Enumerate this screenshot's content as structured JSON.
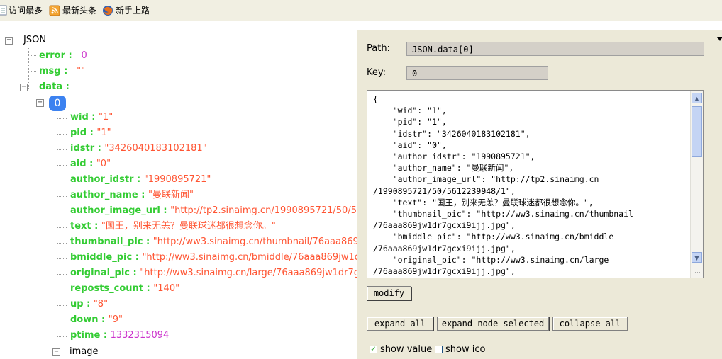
{
  "bookmarks": [
    {
      "label": "访问最多",
      "icon": "page-icon"
    },
    {
      "label": "最新头条",
      "icon": "rss-icon"
    },
    {
      "label": "新手上路",
      "icon": "firefox-icon"
    }
  ],
  "tree": {
    "root": "JSON",
    "error": {
      "key": "error",
      "value": "0"
    },
    "msg": {
      "key": "msg",
      "value": "\"\""
    },
    "data": {
      "key": "data"
    },
    "item_index": "0",
    "fields": [
      {
        "key": "wid",
        "value": "\"1\"",
        "kind": "str"
      },
      {
        "key": "pid",
        "value": "\"1\"",
        "kind": "str"
      },
      {
        "key": "idstr",
        "value": "\"3426040183102181\"",
        "kind": "str"
      },
      {
        "key": "aid",
        "value": "\"0\"",
        "kind": "str"
      },
      {
        "key": "author_idstr",
        "value": "\"1990895721\"",
        "kind": "str"
      },
      {
        "key": "author_name",
        "value": "\"曼联新闻\"",
        "kind": "str"
      },
      {
        "key": "author_image_url",
        "value": "\"http://tp2.sinaimg.cn/1990895721/50/5612239948/1\"",
        "kind": "str"
      },
      {
        "key": "text",
        "value": "\"国王，别来无恙？曼联球迷都很想念你。\"",
        "kind": "str"
      },
      {
        "key": "thumbnail_pic",
        "value": "\"http://ww3.sinaimg.cn/thumbnail/76aaa869jw1dr7gcxi9ijj.jpg\"",
        "kind": "str"
      },
      {
        "key": "bmiddle_pic",
        "value": "\"http://ww3.sinaimg.cn/bmiddle/76aaa869jw1dr7gcxi9ijj.jpg\"",
        "kind": "str"
      },
      {
        "key": "original_pic",
        "value": "\"http://ww3.sinaimg.cn/large/76aaa869jw1dr7gcxi9ijj.jpg\"",
        "kind": "str"
      },
      {
        "key": "reposts_count",
        "value": "\"140\"",
        "kind": "str"
      },
      {
        "key": "up",
        "value": "\"8\"",
        "kind": "str"
      },
      {
        "key": "down",
        "value": "\"9\"",
        "kind": "str"
      },
      {
        "key": "ptime",
        "value": "1332315094",
        "kind": "num"
      }
    ],
    "image_node": "image"
  },
  "panel": {
    "path_label": "Path:",
    "path_value": "JSON.data[0]",
    "key_label": "Key:",
    "key_value": "0",
    "editor_text": "{\n    \"wid\": \"1\",\n    \"pid\": \"1\",\n    \"idstr\": \"3426040183102181\",\n    \"aid\": \"0\",\n    \"author_idstr\": \"1990895721\",\n    \"author_name\": \"曼联新闻\",\n    \"author_image_url\": \"http://tp2.sinaimg.cn\n/1990895721/50/5612239948/1\",\n    \"text\": \"国王，别来无恙？曼联球迷都很想念你。\",\n    \"thumbnail_pic\": \"http://ww3.sinaimg.cn/thumbnail\n/76aaa869jw1dr7gcxi9ijj.jpg\",\n    \"bmiddle_pic\": \"http://ww3.sinaimg.cn/bmiddle\n/76aaa869jw1dr7gcxi9ijj.jpg\",\n    \"original_pic\": \"http://ww3.sinaimg.cn/large\n/76aaa869jw1dr7gcxi9ijj.jpg\",",
    "modify_label": "modify",
    "expand_all_label": "expand all",
    "expand_selected_label": "expand node selected",
    "collapse_all_label": "collapse all",
    "show_value_label": "show value",
    "show_value_checked": true,
    "show_ico_label": "show ico",
    "show_ico_checked": false
  }
}
